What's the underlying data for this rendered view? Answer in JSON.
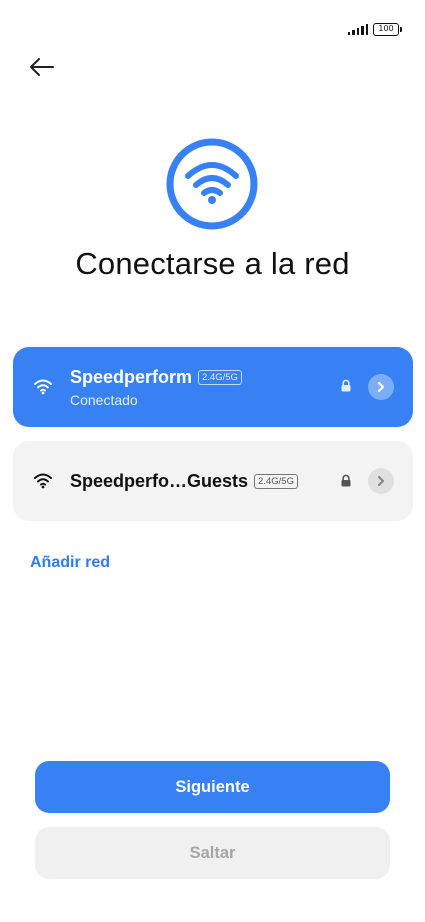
{
  "status_bar": {
    "battery_level": "100"
  },
  "header": {
    "title": "Conectarse a la red"
  },
  "networks": [
    {
      "name": "Speedperform",
      "band": "2.4G/5G",
      "status": "Conectado",
      "secured": true,
      "connected": true
    },
    {
      "name": "Speedperfo…Guests",
      "band": "2.4G/5G",
      "secured": true,
      "connected": false
    }
  ],
  "add_network_label": "Añadir red",
  "buttons": {
    "next_label": "Siguiente",
    "skip_label": "Saltar"
  },
  "colors": {
    "accent": "#3781f4",
    "link": "#2f7bf0",
    "card_background": "#f3f3f3",
    "disabled_text": "#a6a6a6"
  },
  "icons": [
    "signal-icon",
    "battery-icon",
    "back-arrow-icon",
    "wifi-hero-icon",
    "wifi-icon",
    "lock-icon",
    "chevron-right-icon"
  ]
}
